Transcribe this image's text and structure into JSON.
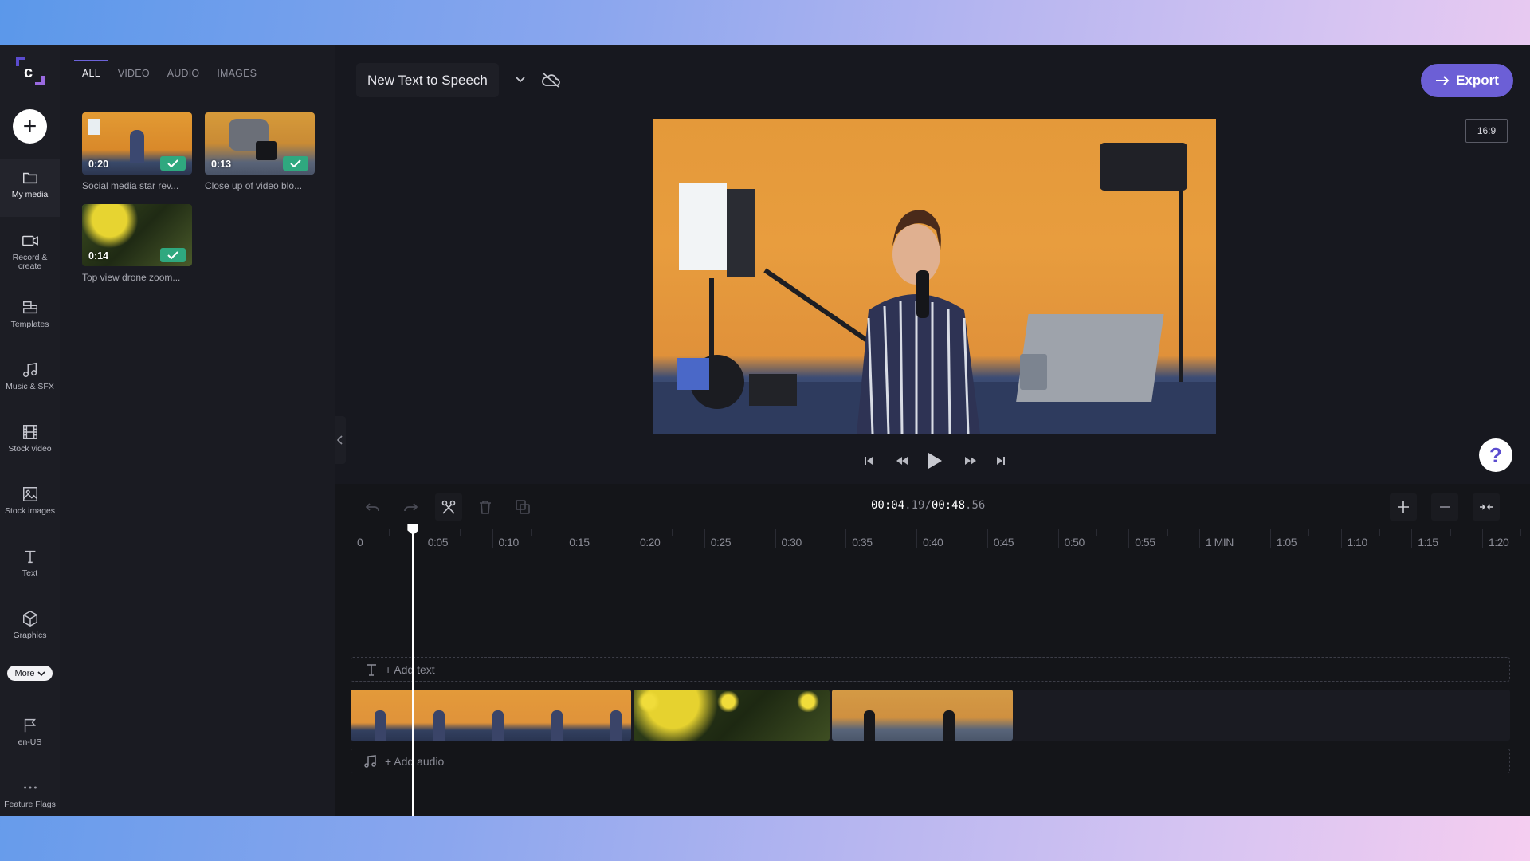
{
  "app": {
    "brand_letter": "c",
    "add_button_label": "+"
  },
  "sidebar": {
    "items": [
      {
        "id": "my-media",
        "label": "My media",
        "icon": "folder-icon",
        "active": true
      },
      {
        "id": "record-create",
        "label": "Record & create",
        "label_line1": "Record &",
        "label_line2": "create",
        "icon": "video-camera-icon",
        "active": false
      },
      {
        "id": "templates",
        "label": "Templates",
        "icon": "templates-icon",
        "active": false
      },
      {
        "id": "music-sfx",
        "label": "Music & SFX",
        "icon": "music-note-icon",
        "active": false
      },
      {
        "id": "stock-video",
        "label": "Stock video",
        "icon": "film-icon",
        "active": false
      },
      {
        "id": "stock-images",
        "label": "Stock images",
        "icon": "image-icon",
        "active": false
      },
      {
        "id": "text",
        "label": "Text",
        "icon": "text-icon",
        "active": false
      },
      {
        "id": "graphics",
        "label": "Graphics",
        "icon": "cube-icon",
        "active": false
      }
    ],
    "more_label": "More",
    "locale": {
      "label": "en-US",
      "icon": "flag-icon"
    },
    "feature_flags": {
      "label": "Feature Flags",
      "icon": "more-dots-icon"
    }
  },
  "media_panel": {
    "tabs": [
      {
        "label": "ALL",
        "active": true
      },
      {
        "label": "VIDEO",
        "active": false
      },
      {
        "label": "AUDIO",
        "active": false
      },
      {
        "label": "IMAGES",
        "active": false
      }
    ],
    "items": [
      {
        "name": "Social media star rev...",
        "duration": "0:20",
        "added": true
      },
      {
        "name": "Close up of video blo...",
        "duration": "0:13",
        "added": true
      },
      {
        "name": "Top view drone zoom...",
        "duration": "0:14",
        "added": true
      }
    ]
  },
  "header": {
    "project_title": "New Text to Speech",
    "save_status_icon": "cloud-off-icon",
    "export_label": "Export",
    "aspect_ratio": "16:9"
  },
  "player": {
    "controls": [
      "skip-to-start",
      "rewind",
      "play",
      "fast-forward",
      "skip-to-end"
    ]
  },
  "timeline": {
    "current_time_main": "00:04",
    "current_time_frac": ".19",
    "separator": "/",
    "total_time_main": "00:48",
    "total_time_frac": ".56",
    "ruler_labels": [
      "0",
      "0:05",
      "0:10",
      "0:15",
      "0:20",
      "0:25",
      "0:30",
      "0:35",
      "0:40",
      "0:45",
      "0:50",
      "0:55",
      "1 MIN",
      "1:05",
      "1:10",
      "1:15",
      "1:20"
    ],
    "playhead_seconds": 4.19,
    "add_text_label": "+ Add text",
    "add_audio_label": "+ Add audio",
    "clips": [
      {
        "source": "Social media star rev...",
        "duration_s": 20
      },
      {
        "source": "Top view drone zoom...",
        "duration_s": 14
      },
      {
        "source": "Close up of video blo...",
        "duration_s": 13
      }
    ]
  },
  "colors": {
    "accent": "#6c5fd6",
    "check_green": "#2fa87f",
    "app_bg": "#17181f",
    "sidebar_bg": "#1c1d24"
  }
}
